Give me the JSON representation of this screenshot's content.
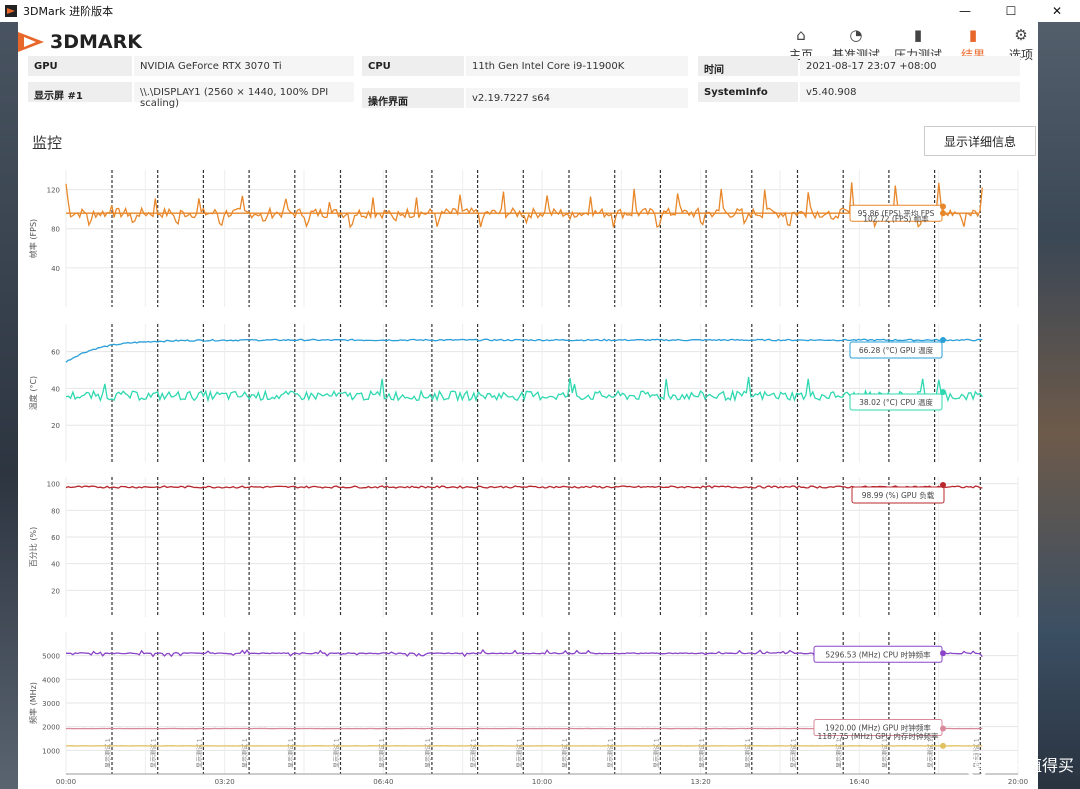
{
  "window": {
    "title": "3DMark 进阶版本",
    "minimize": "—",
    "maximize": "☐",
    "close": "✕"
  },
  "logo": {
    "text": "3DMARK"
  },
  "nav": [
    {
      "label": "主页",
      "icon": "home-icon",
      "glyph": "⌂",
      "active": false
    },
    {
      "label": "基准测试",
      "icon": "gauge-icon",
      "glyph": "◔",
      "active": false
    },
    {
      "label": "压力测试",
      "icon": "bars-icon",
      "glyph": "▮",
      "active": false
    },
    {
      "label": "结果",
      "icon": "results-icon",
      "glyph": "▮",
      "active": true
    },
    {
      "label": "选项",
      "icon": "gear-icon",
      "glyph": "⚙",
      "active": false
    }
  ],
  "info": {
    "row1": [
      {
        "key": "GPU",
        "value": "NVIDIA GeForce RTX 3070 Ti"
      },
      {
        "key": "CPU",
        "value": "11th Gen Intel Core i9-11900K"
      },
      {
        "key": "时间",
        "value": "2021-08-17 23:07 +08:00"
      }
    ],
    "row2": [
      {
        "key": "显示屏 #1",
        "value": "\\\\.\\DISPLAY1 (2560 × 1440, 100% DPI scaling)"
      },
      {
        "key": "操作界面",
        "value": "v2.19.7227 s64"
      },
      {
        "key": "SystemInfo",
        "value": "v5.40.908"
      }
    ]
  },
  "monitor": {
    "title": "监控",
    "detail_button": "显示详细信息"
  },
  "chart_data": {
    "type": "line",
    "x_ticks": [
      "00:00",
      "03:20",
      "06:40",
      "10:00",
      "13:20",
      "16:40",
      "20:00"
    ],
    "x_range_seconds": [
      0,
      1200
    ],
    "marker_label": "显示测试 1",
    "panels": [
      {
        "ylabel": "帧率 (FPS)",
        "yticks": [
          40,
          80,
          120
        ],
        "ylim": [
          0,
          140
        ],
        "series": [
          {
            "name": "平均 FPS",
            "value": "95.86 (FPS) 平均 FPS",
            "color": "#e8872a",
            "level": 95.86
          },
          {
            "name": "帧率",
            "value": "102.72 (FPS) 帧率",
            "color": "#e8872a",
            "level": 102.72
          }
        ]
      },
      {
        "ylabel": "温度 (°C)",
        "yticks": [
          20,
          40,
          60
        ],
        "ylim": [
          0,
          75
        ],
        "series": [
          {
            "name": "GPU 温度",
            "value": "66.28 (°C) GPU 温度",
            "color": "#2a9fd8",
            "level": 66.28
          },
          {
            "name": "CPU 温度",
            "value": "38.02 (°C) CPU 温度",
            "color": "#2fd8b0",
            "level": 38.02
          }
        ]
      },
      {
        "ylabel": "百分比 (%)",
        "yticks": [
          20,
          40,
          60,
          80,
          100
        ],
        "ylim": [
          0,
          105
        ],
        "series": [
          {
            "name": "GPU 负载",
            "value": "98.99 (%) GPU 负载",
            "color": "#b8282e",
            "level": 98.99
          }
        ]
      },
      {
        "ylabel": "频率 (MHz)",
        "yticks": [
          1000,
          2000,
          3000,
          4000,
          5000
        ],
        "ylim": [
          0,
          6000
        ],
        "series": [
          {
            "name": "CPU 时钟频率",
            "value": "5296.53 (MHz) CPU 时钟频率",
            "color": "#8a45c8",
            "level": 5100
          },
          {
            "name": "GPU 时钟频率",
            "value": "1920.00 (MHz) GPU 时钟频率",
            "color": "#d88a9a",
            "level": 1920
          },
          {
            "name": "GPU 内存时钟频率",
            "value": "1187.75 (MHz) GPU 内存时钟频率",
            "color": "#e0c060",
            "level": 1187.75
          }
        ]
      }
    ]
  },
  "watermark": {
    "text": "什么值得买",
    "glyph": "值"
  }
}
